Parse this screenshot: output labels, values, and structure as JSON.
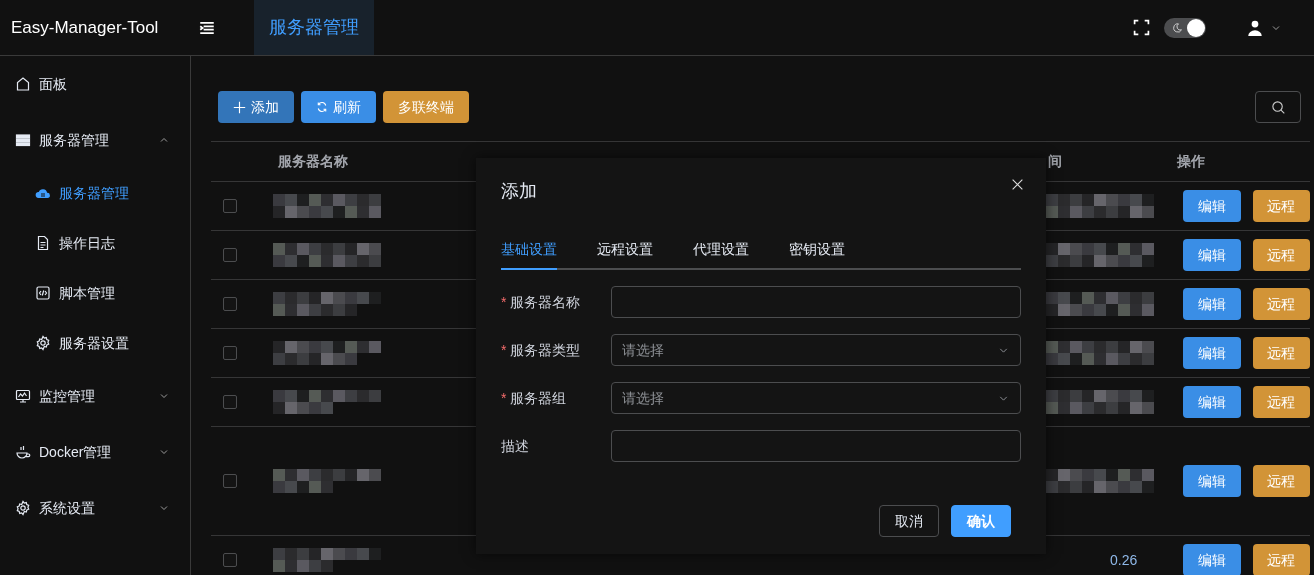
{
  "app": {
    "title": "Easy-Manager-Tool"
  },
  "header_tabs": [
    {
      "label": "服务器管理",
      "selected": true
    }
  ],
  "theme_switch": {
    "on": true
  },
  "sidebar": {
    "items": [
      {
        "label": "面板",
        "selected": false
      },
      {
        "label": "服务器管理",
        "selected": false,
        "expanded": true,
        "children": [
          {
            "label": "服务器管理",
            "selected": true
          },
          {
            "label": "操作日志",
            "selected": false
          },
          {
            "label": "脚本管理",
            "selected": false
          },
          {
            "label": "服务器设置",
            "selected": false
          }
        ]
      },
      {
        "label": "监控管理",
        "selected": false,
        "expanded": false
      },
      {
        "label": "Docker管理",
        "selected": false,
        "expanded": false
      },
      {
        "label": "系统设置",
        "selected": false,
        "expanded": false
      }
    ]
  },
  "toolbar": {
    "buttons": [
      {
        "label": "添加",
        "kind": "primary"
      },
      {
        "label": "刷新",
        "kind": "info"
      },
      {
        "label": "多联终端",
        "kind": "warning"
      }
    ]
  },
  "table": {
    "columns": [
      {
        "label": "服务器名称"
      },
      {
        "label": "间"
      },
      {
        "label": "操作"
      }
    ],
    "rows": [
      {
        "checked": false,
        "actions": [
          "编辑",
          "远程"
        ]
      },
      {
        "checked": false,
        "actions": [
          "编辑",
          "远程"
        ]
      },
      {
        "checked": false,
        "actions": [
          "编辑",
          "远程"
        ]
      },
      {
        "checked": false,
        "actions": [
          "编辑",
          "远程"
        ]
      },
      {
        "checked": false,
        "actions": [
          "编辑",
          "远程"
        ]
      },
      {
        "checked": false,
        "actions": [
          "编辑",
          "远程"
        ]
      },
      {
        "checked": false,
        "actions": [
          "编辑",
          "远程"
        ],
        "column_4": "0.26"
      }
    ]
  },
  "dialog": {
    "title": "添加",
    "tabs": [
      {
        "label": "基础设置",
        "selected": true
      },
      {
        "label": "远程设置",
        "selected": false
      },
      {
        "label": "代理设置",
        "selected": false
      },
      {
        "label": "密钥设置",
        "selected": false
      }
    ],
    "fields": [
      {
        "required_mark": "*",
        "label": "服务器名称",
        "kind": "input"
      },
      {
        "required_mark": "*",
        "label": "服务器类型",
        "kind": "select",
        "placeholder": "请选择"
      },
      {
        "required_mark": "*",
        "label": "服务器组",
        "kind": "select",
        "placeholder": "请选择"
      },
      {
        "label": "描述",
        "kind": "input"
      }
    ],
    "buttons": [
      {
        "label": "取消",
        "kind": "default"
      },
      {
        "label": "确认",
        "kind": "primary"
      }
    ]
  }
}
